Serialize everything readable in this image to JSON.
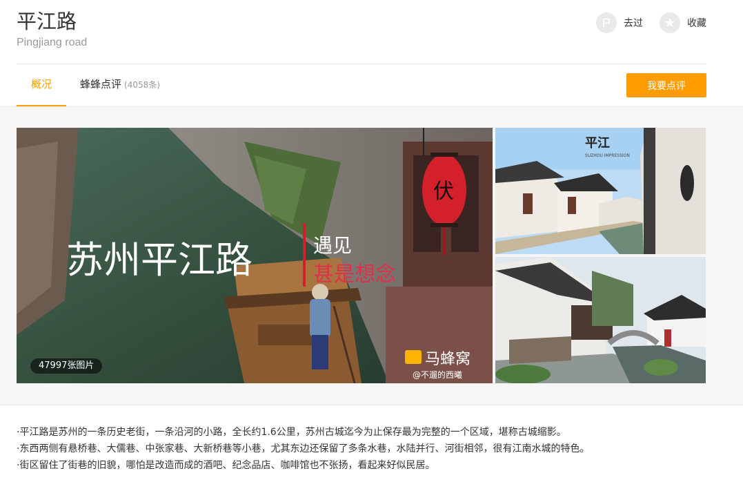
{
  "poi": {
    "title": "平江路",
    "subtitle": "Pingjiang road"
  },
  "actions": {
    "been_label": "去过",
    "collect_label": "收藏"
  },
  "tabs": {
    "overview": "概况",
    "reviews": "蜂蜂点评",
    "reviews_count": "(4058条)",
    "write_review": "我要点评"
  },
  "gallery": {
    "photo_count": "47997张图片",
    "main_overlay_title": "苏州平江路",
    "main_overlay_sub1": "遇见",
    "main_overlay_sub2": "甚是想念",
    "lantern_char": "伏",
    "watermark_brand": "马蜂窝",
    "watermark_user": "@不遛的西曦",
    "side1_logo": "平江",
    "side1_logo_sub": "SUZHOU IMPRESSION"
  },
  "description": [
    "·平江路是苏州的一条历史老街，一条沿河的小路，全长约1.6公里，苏州古城迄今为止保存最为完整的一个区域，堪称古城缩影。",
    "·东西两侧有悬桥巷、大儒巷、中张家巷、大新桥巷等小巷，尤其东边还保留了多条水巷，水陆并行、河街相邻，很有江南水城的特色。",
    "·街区留住了街巷的旧貌，哪怕是改造而成的酒吧、纪念品店、咖啡馆也不张扬，看起来好似民居。"
  ],
  "colors": {
    "accent": "#ff9d00",
    "muted": "#999999"
  }
}
